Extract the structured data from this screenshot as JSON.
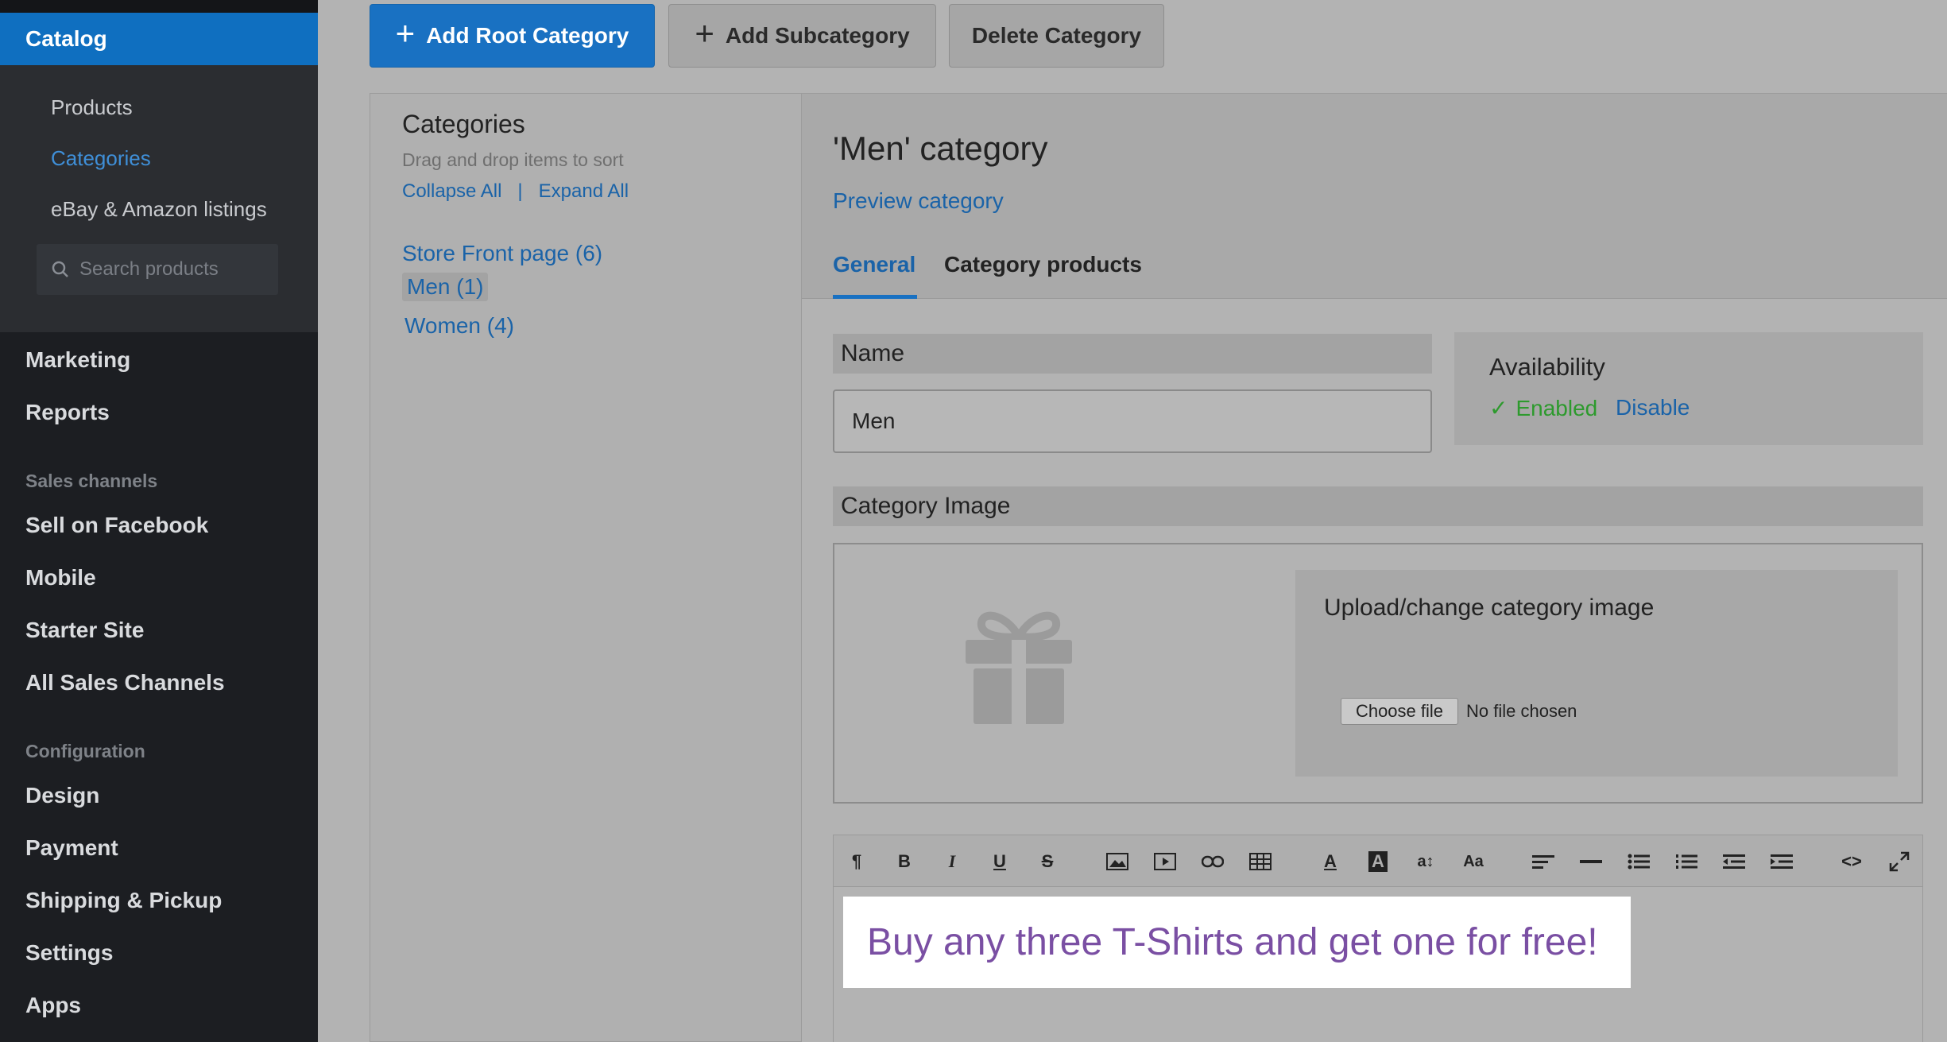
{
  "sidebar": {
    "catalog_label": "Catalog",
    "catalog_items": [
      {
        "label": "Products",
        "active": false
      },
      {
        "label": "Categories",
        "active": true
      },
      {
        "label": "eBay & Amazon listings",
        "active": false
      }
    ],
    "search_placeholder": "Search products",
    "nav_top": [
      "Marketing",
      "Reports"
    ],
    "sales_channels_heading": "Sales channels",
    "sales_channels": [
      "Sell on Facebook",
      "Mobile",
      "Starter Site",
      "All Sales Channels"
    ],
    "configuration_heading": "Configuration",
    "configuration": [
      "Design",
      "Payment",
      "Shipping & Pickup",
      "Settings",
      "Apps"
    ]
  },
  "toolbar": {
    "add_root_label": "Add Root Category",
    "add_sub_label": "Add Subcategory",
    "delete_label": "Delete Category"
  },
  "categories_panel": {
    "title": "Categories",
    "hint": "Drag and drop items to sort",
    "collapse_all": "Collapse All",
    "separator": "|",
    "expand_all": "Expand All",
    "tree": [
      {
        "label": "Store Front page (6)",
        "selected": false
      },
      {
        "label": "Men (1)",
        "selected": true
      },
      {
        "label": "Women (4)",
        "selected": false
      }
    ]
  },
  "category_editor": {
    "title": "'Men' category",
    "preview_link": "Preview category",
    "tabs": [
      {
        "label": "General",
        "active": true
      },
      {
        "label": "Category products",
        "active": false
      }
    ],
    "name_label": "Name",
    "name_value": "Men",
    "availability_title": "Availability",
    "availability_status": "Enabled",
    "availability_action": "Disable",
    "image_label": "Category Image",
    "upload_title": "Upload/change category image",
    "choose_file": "Choose file",
    "no_file": "No file chosen",
    "editor_text": "Buy any three T-Shirts and get one for free!"
  },
  "editor_toolbar_icons": [
    "paragraph-icon",
    "bold-icon",
    "italic-icon",
    "underline-icon",
    "strikethrough-icon",
    "image-icon",
    "video-icon",
    "link-icon",
    "table-icon",
    "font-color-icon",
    "background-color-icon",
    "font-size-icon",
    "font-family-icon",
    "align-icon",
    "horizontal-rule-icon",
    "unordered-list-icon",
    "ordered-list-icon",
    "outdent-icon",
    "indent-icon",
    "code-view-icon",
    "fullscreen-icon"
  ],
  "colors": {
    "accent": "#1971c2",
    "link": "#1a63a8",
    "enabled": "#2d9a2d",
    "promo_text": "#7a4fa3"
  }
}
